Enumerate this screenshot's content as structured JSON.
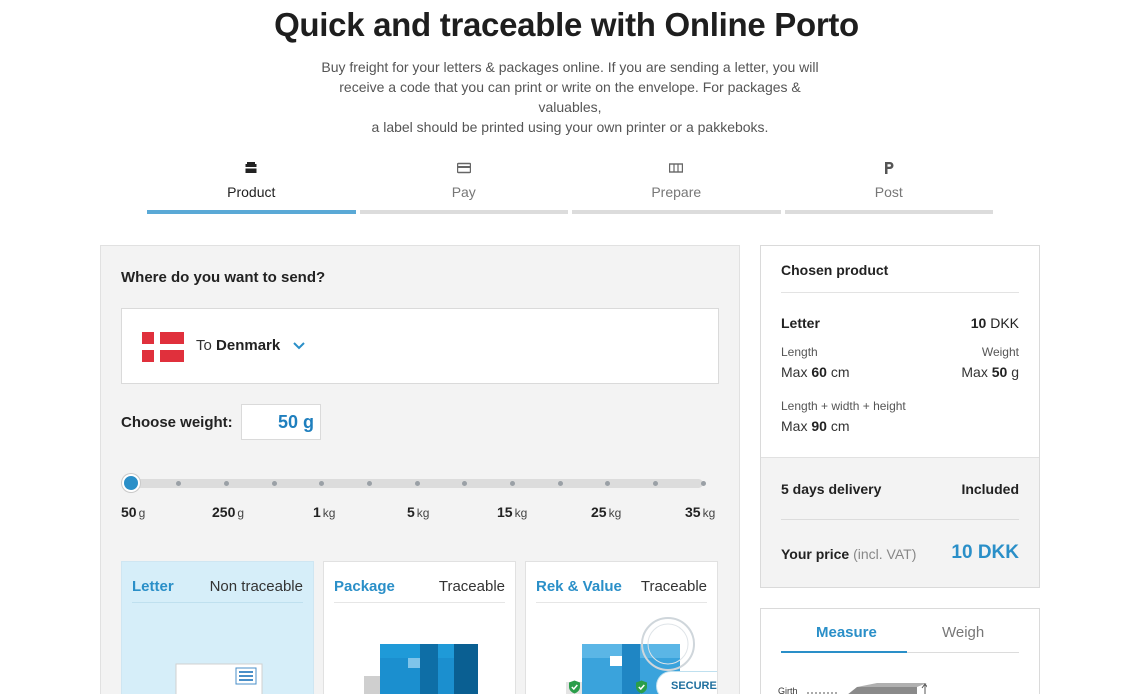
{
  "header": {
    "title": "Quick and traceable with Online Porto",
    "intro_lines": [
      "Buy freight for your letters & packages online. If you are sending a letter, you will",
      "receive a code that you can print or write on the envelope. For packages & valuables,",
      "a label should be printed using your own printer or a pakkeboks."
    ]
  },
  "steps": [
    {
      "label": "Product",
      "icon": "box-icon"
    },
    {
      "label": "Pay",
      "icon": "card-icon"
    },
    {
      "label": "Prepare",
      "icon": "label-icon"
    },
    {
      "label": "Post",
      "icon": "post-icon"
    }
  ],
  "destination": {
    "question": "Where do you want to send?",
    "prefix": "To",
    "country": "Denmark"
  },
  "weight": {
    "label": "Choose weight:",
    "value": "50 g",
    "slider_level": 0,
    "stops": [
      {
        "num": "50",
        "unit": "g"
      },
      {
        "num": "250",
        "unit": "g"
      },
      {
        "num": "1",
        "unit": "kg"
      },
      {
        "num": "5",
        "unit": "kg"
      },
      {
        "num": "15",
        "unit": "kg"
      },
      {
        "num": "25",
        "unit": "kg"
      },
      {
        "num": "35",
        "unit": "kg"
      }
    ]
  },
  "products": [
    {
      "name": "Letter",
      "trace": "Non traceable"
    },
    {
      "name": "Package",
      "trace": "Traceable"
    },
    {
      "name": "Rek & Value",
      "trace": "Traceable",
      "badge": "SECURE"
    }
  ],
  "chosen": {
    "title": "Chosen product",
    "product": "Letter",
    "price_num": "10",
    "price_unit": "DKK",
    "length_label": "Length",
    "length_prefix": "Max",
    "length_num": "60",
    "length_unit": "cm",
    "weight_label": "Weight",
    "weight_prefix": "Max",
    "weight_num": "50",
    "weight_unit": "g",
    "lwh_label": "Length + width + height",
    "lwh_prefix": "Max",
    "lwh_num": "90",
    "lwh_unit": "cm",
    "delivery": "5 days delivery",
    "delivery_status": "Included",
    "your_price": "Your price",
    "vat_note": "(incl. VAT)",
    "total": "10 DKK"
  },
  "measure": {
    "tab_measure": "Measure",
    "tab_weigh": "Weigh",
    "girth": "Girth"
  },
  "colors": {
    "accent": "#2a8fc8",
    "step_active": "#5aa9d6",
    "card_selected": "#d6eef9",
    "flag_red": "#e0303c"
  }
}
